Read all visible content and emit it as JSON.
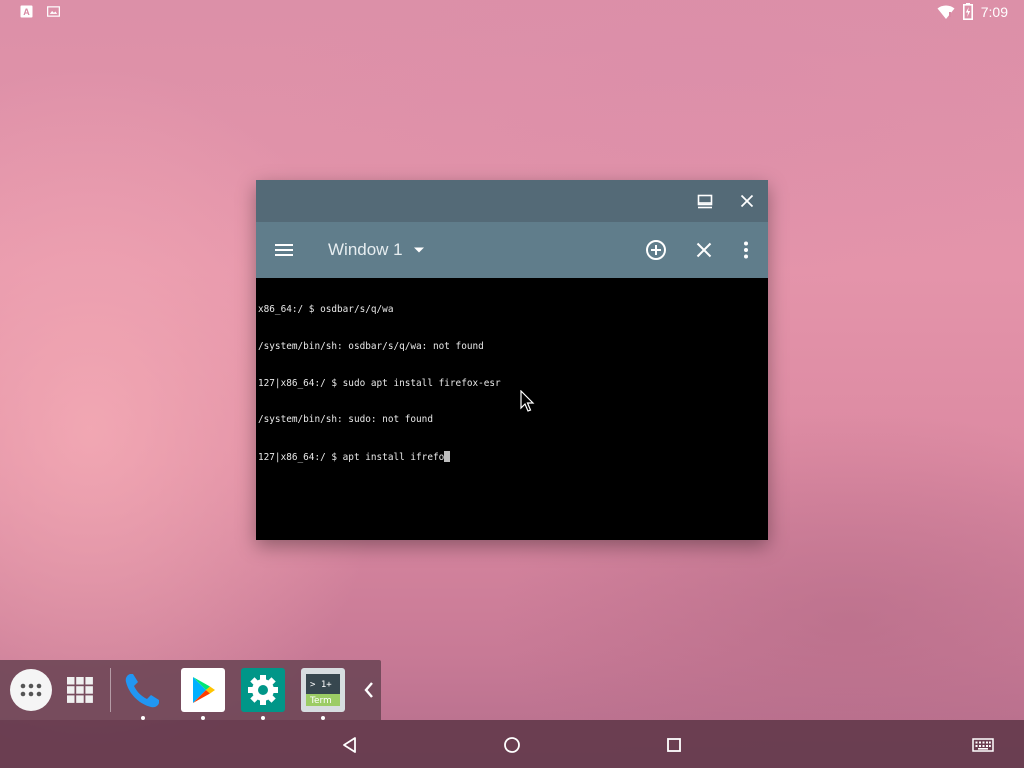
{
  "status_bar": {
    "left_icons": [
      "keyboard-a-icon",
      "screenshot-icon"
    ],
    "right_icons": [
      "wifi-icon",
      "battery-charging-icon"
    ],
    "time": "7:09"
  },
  "terminal_window": {
    "caption_buttons": [
      "maximize-icon",
      "close-icon"
    ],
    "toolbar": {
      "menu_icon": "hamburger-menu-icon",
      "window_title": "Window 1",
      "dropdown_icon": "dropdown-arrow-icon",
      "actions": [
        "add-window-icon",
        "close-window-icon",
        "overflow-menu-icon"
      ]
    },
    "terminal_lines": [
      "x86_64:/ $ osdbar/s/q/wa",
      "/system/bin/sh: osdbar/s/q/wa: not found",
      "127|x86_64:/ $ sudo apt install firefox-esr",
      "/system/bin/sh: sudo: not found"
    ],
    "current_prompt": "127|x86_64:/ $ apt install ifrefo"
  },
  "dock": {
    "items": [
      {
        "name": "all-apps",
        "icon": "app-drawer-dots-icon"
      },
      {
        "name": "recent-apps-grid",
        "icon": "grid-icon"
      },
      {
        "name": "phone",
        "icon": "phone-icon",
        "running": true
      },
      {
        "name": "play-store",
        "icon": "play-store-icon",
        "running": true
      },
      {
        "name": "settings",
        "icon": "settings-gear-icon",
        "running": true
      },
      {
        "name": "terminal-emulator",
        "icon": "terminal-icon",
        "running": true,
        "label": "> 1+\nTerm"
      }
    ],
    "collapse_icon": "chevron-left-icon",
    "colors": {
      "play_bg": "#ffffff",
      "settings_bg": "#009688",
      "term_bg": "#9ccc65"
    }
  },
  "nav_bar": {
    "buttons": [
      "back-icon",
      "home-icon",
      "recents-icon"
    ],
    "right_icon": "keyboard-icon"
  }
}
